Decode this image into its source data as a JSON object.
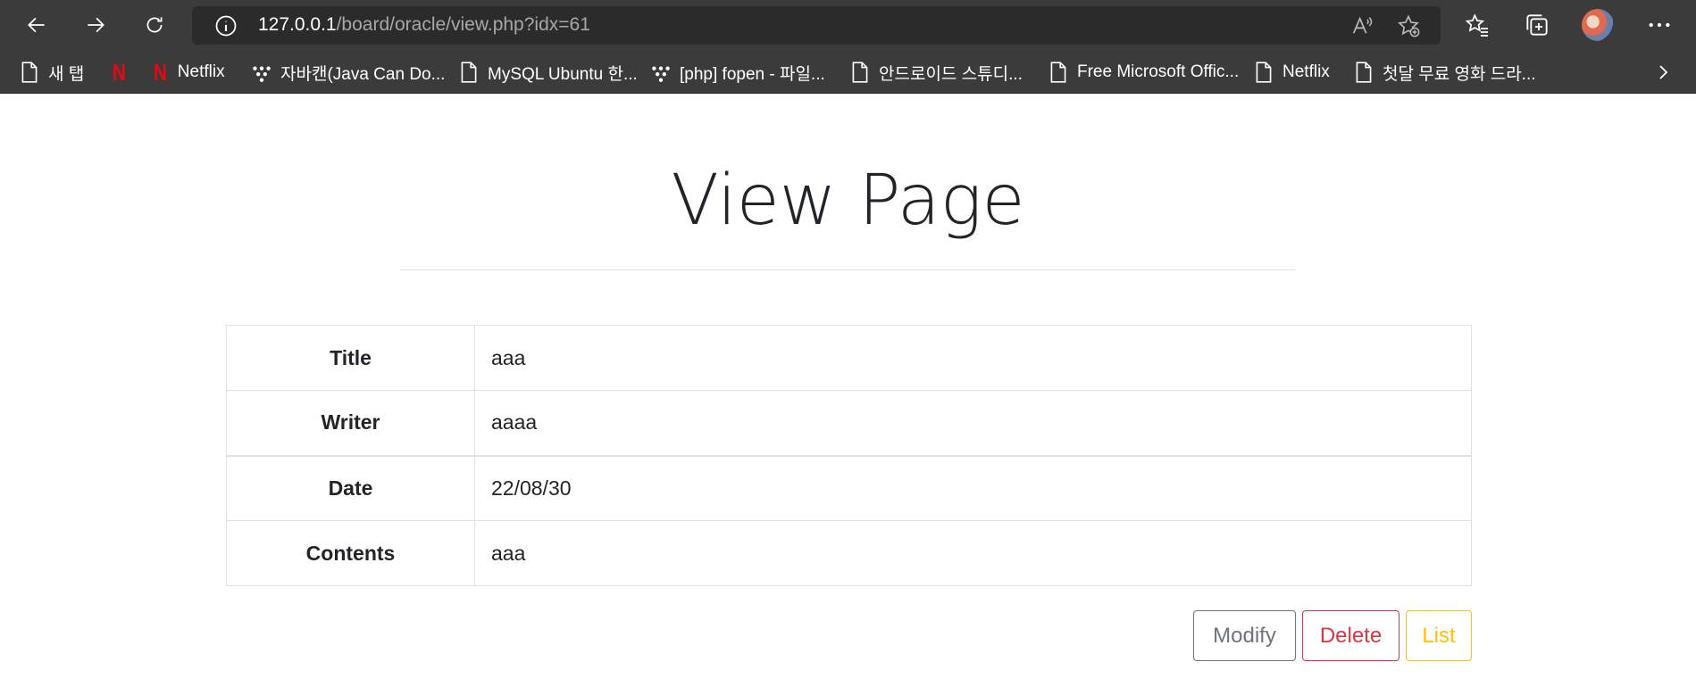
{
  "browser": {
    "url_host": "127.0.0.1",
    "url_path": "/board/oracle/view.php?idx=61",
    "bookmarks": [
      {
        "label": "새 탭",
        "icon": "page-icon"
      },
      {
        "label": "",
        "icon": "netflix-logo-icon"
      },
      {
        "label": "Netflix",
        "icon": "netflix-logo-icon"
      },
      {
        "label": "자바캔(Java Can Do...",
        "icon": "dots-icon"
      },
      {
        "label": "MySQL Ubuntu 한...",
        "icon": "page-icon"
      },
      {
        "label": "[php] fopen - 파일...",
        "icon": "dots-icon"
      },
      {
        "label": "안드로이드 스튜디...",
        "icon": "page-icon"
      },
      {
        "label": "Free Microsoft Offic...",
        "icon": "page-icon"
      },
      {
        "label": "Netflix",
        "icon": "page-icon"
      },
      {
        "label": "첫달 무료 영화 드라...",
        "icon": "page-icon"
      }
    ]
  },
  "page": {
    "title": "View Page"
  },
  "post": {
    "rows": [
      {
        "label": "Title",
        "value": "aaa"
      },
      {
        "label": "Writer",
        "value": "aaaa"
      },
      {
        "label": "Date",
        "value": "22/08/30"
      },
      {
        "label": "Contents",
        "value": "aaa"
      }
    ]
  },
  "actions": {
    "modify_label": "Modify",
    "delete_label": "Delete",
    "list_label": "List"
  },
  "colors": {
    "modify": "#6c757d",
    "delete": "#dc3545",
    "list": "#ffc107",
    "netflix": "#e50914"
  }
}
